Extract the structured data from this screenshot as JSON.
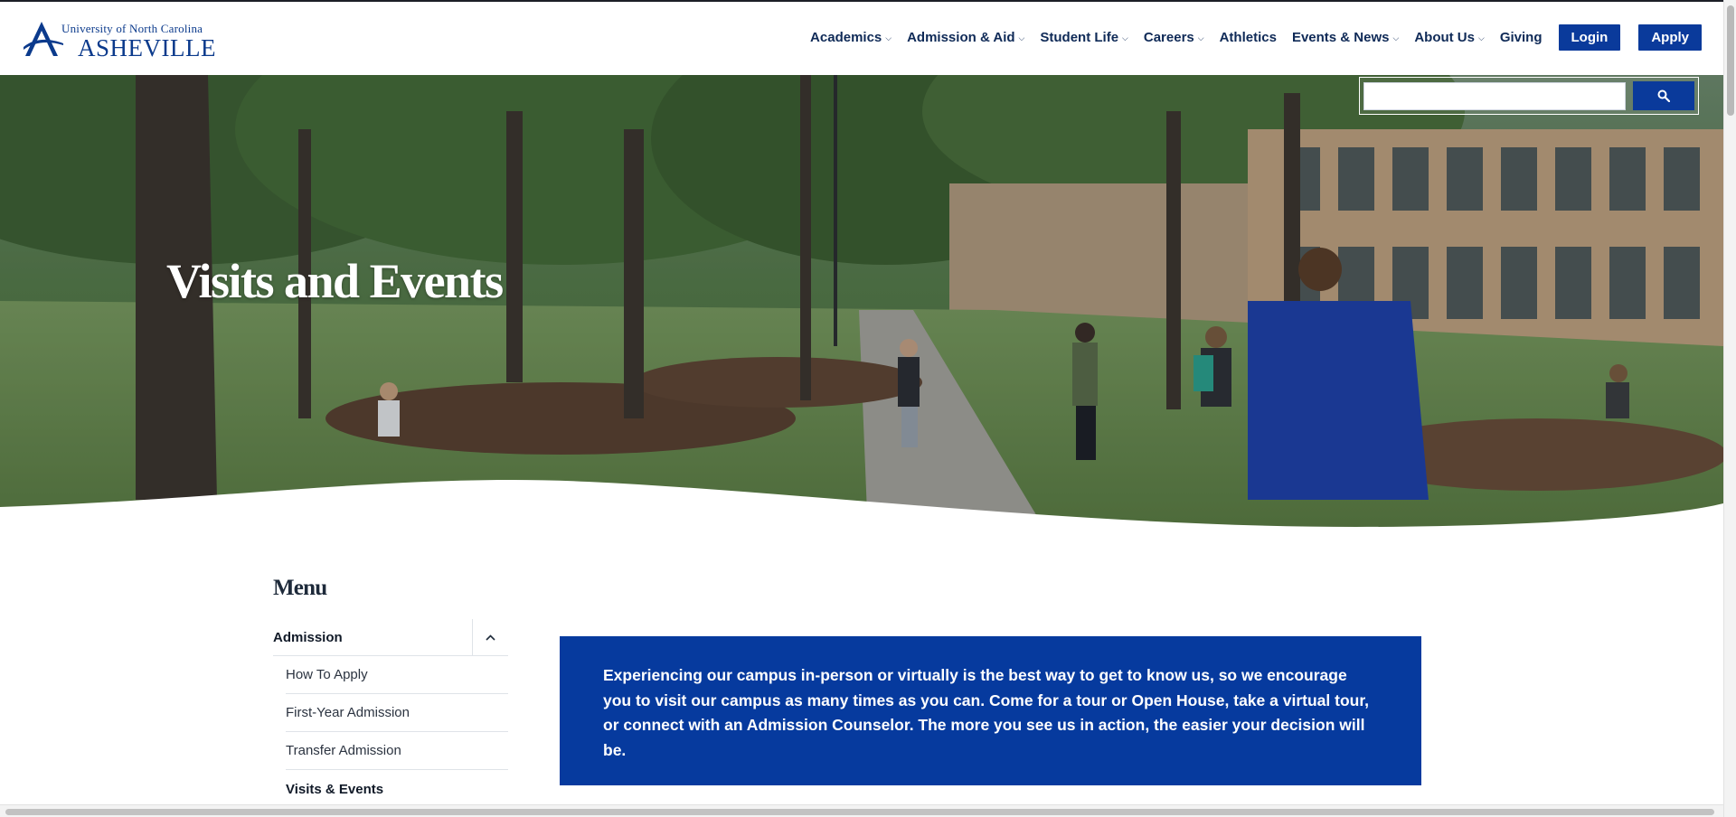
{
  "header": {
    "logo_line1": "University of North Carolina",
    "logo_line2": "ASHEVILLE",
    "nav": [
      {
        "label": "Academics",
        "has_dropdown": true
      },
      {
        "label": "Admission & Aid",
        "has_dropdown": true
      },
      {
        "label": "Student Life",
        "has_dropdown": true
      },
      {
        "label": "Careers",
        "has_dropdown": true
      },
      {
        "label": "Athletics",
        "has_dropdown": false
      },
      {
        "label": "Events & News",
        "has_dropdown": true
      },
      {
        "label": "About Us",
        "has_dropdown": true
      },
      {
        "label": "Giving",
        "has_dropdown": false
      }
    ],
    "login_label": "Login",
    "apply_label": "Apply",
    "chevron_glyph": "⌵"
  },
  "search": {
    "value": "",
    "button_icon": "search-icon"
  },
  "hero": {
    "title": "Visits and Events"
  },
  "sidebar": {
    "menu_title": "Menu",
    "section_label": "Admission",
    "items": [
      {
        "label": "How To Apply",
        "active": false
      },
      {
        "label": "First-Year Admission",
        "active": false
      },
      {
        "label": "Transfer Admission",
        "active": false
      },
      {
        "label": "Visits & Events",
        "active": true
      }
    ]
  },
  "intro": {
    "text": "Experiencing our campus in-person or virtually is the best way to get to know us, so we encourage you to visit our campus as many times as you can. Come for a tour or Open House, take a virtual tour, or connect with an Admission Counselor. The more you see us in action, the easier your decision will be."
  },
  "colors": {
    "brand_blue": "#0a3a9b",
    "nav_text": "#0f2a57",
    "intro_bg": "#063a9e"
  }
}
